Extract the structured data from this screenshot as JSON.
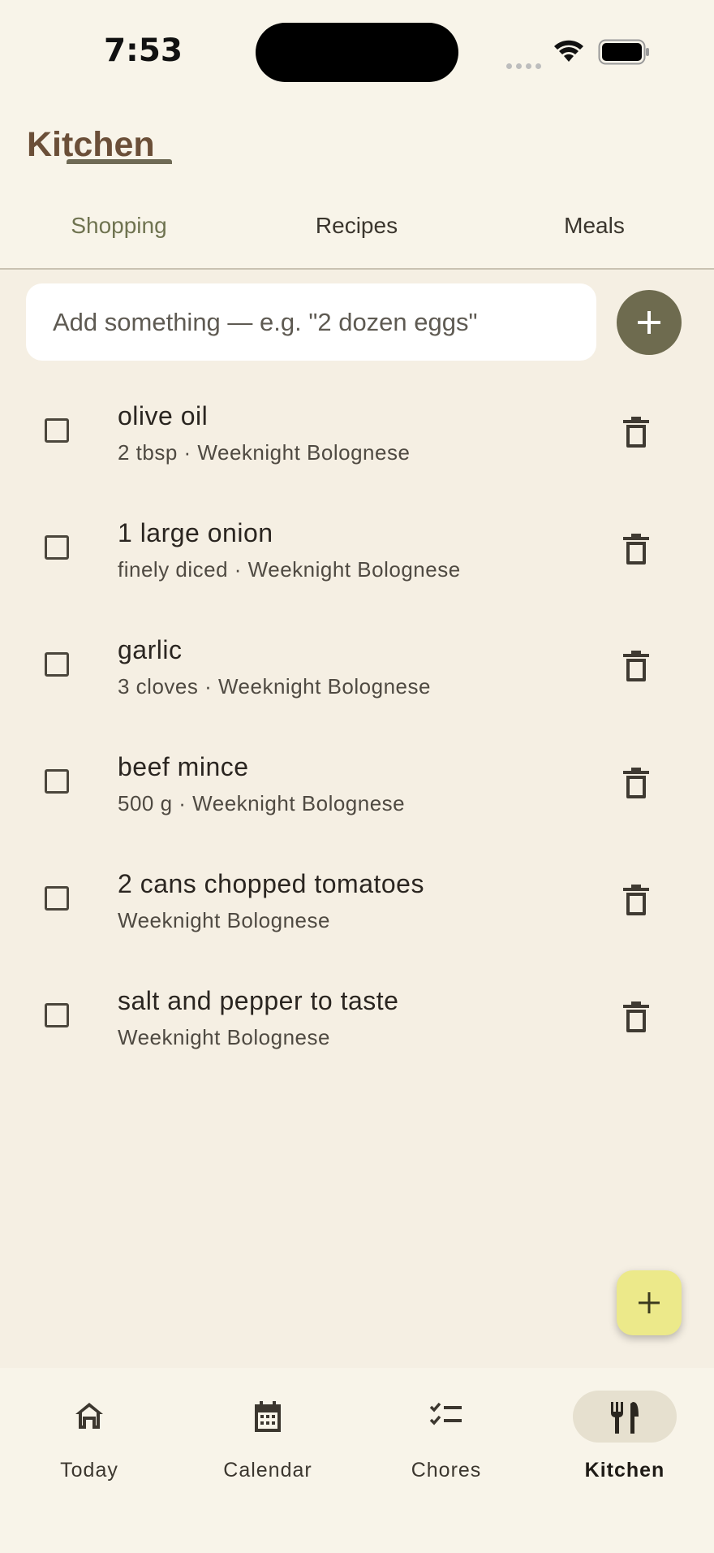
{
  "status": {
    "time": "7:53"
  },
  "header": {
    "title": "Kitchen"
  },
  "tabs": [
    {
      "label": "Shopping",
      "active": true
    },
    {
      "label": "Recipes",
      "active": false
    },
    {
      "label": "Meals",
      "active": false
    }
  ],
  "add": {
    "placeholder": "Add something — e.g. \"2 dozen eggs\""
  },
  "items": [
    {
      "title": "olive oil",
      "subtitle": "2 tbsp · Weeknight Bolognese"
    },
    {
      "title": "1 large onion",
      "subtitle": "finely diced · Weeknight Bolognese"
    },
    {
      "title": "garlic",
      "subtitle": "3 cloves · Weeknight Bolognese"
    },
    {
      "title": "beef mince",
      "subtitle": "500 g · Weeknight Bolognese"
    },
    {
      "title": "2 cans chopped tomatoes",
      "subtitle": "Weeknight Bolognese"
    },
    {
      "title": "salt and pepper to taste",
      "subtitle": "Weeknight Bolognese"
    }
  ],
  "nav": [
    {
      "label": "Today",
      "icon": "home-icon",
      "active": false
    },
    {
      "label": "Calendar",
      "icon": "calendar-icon",
      "active": false
    },
    {
      "label": "Chores",
      "icon": "checklist-icon",
      "active": false
    },
    {
      "label": "Kitchen",
      "icon": "utensils-icon",
      "active": true
    }
  ],
  "colors": {
    "background": "#f5efe3",
    "title": "#6b4f38",
    "accent": "#6e6b4f",
    "fab": "#ece98a"
  }
}
